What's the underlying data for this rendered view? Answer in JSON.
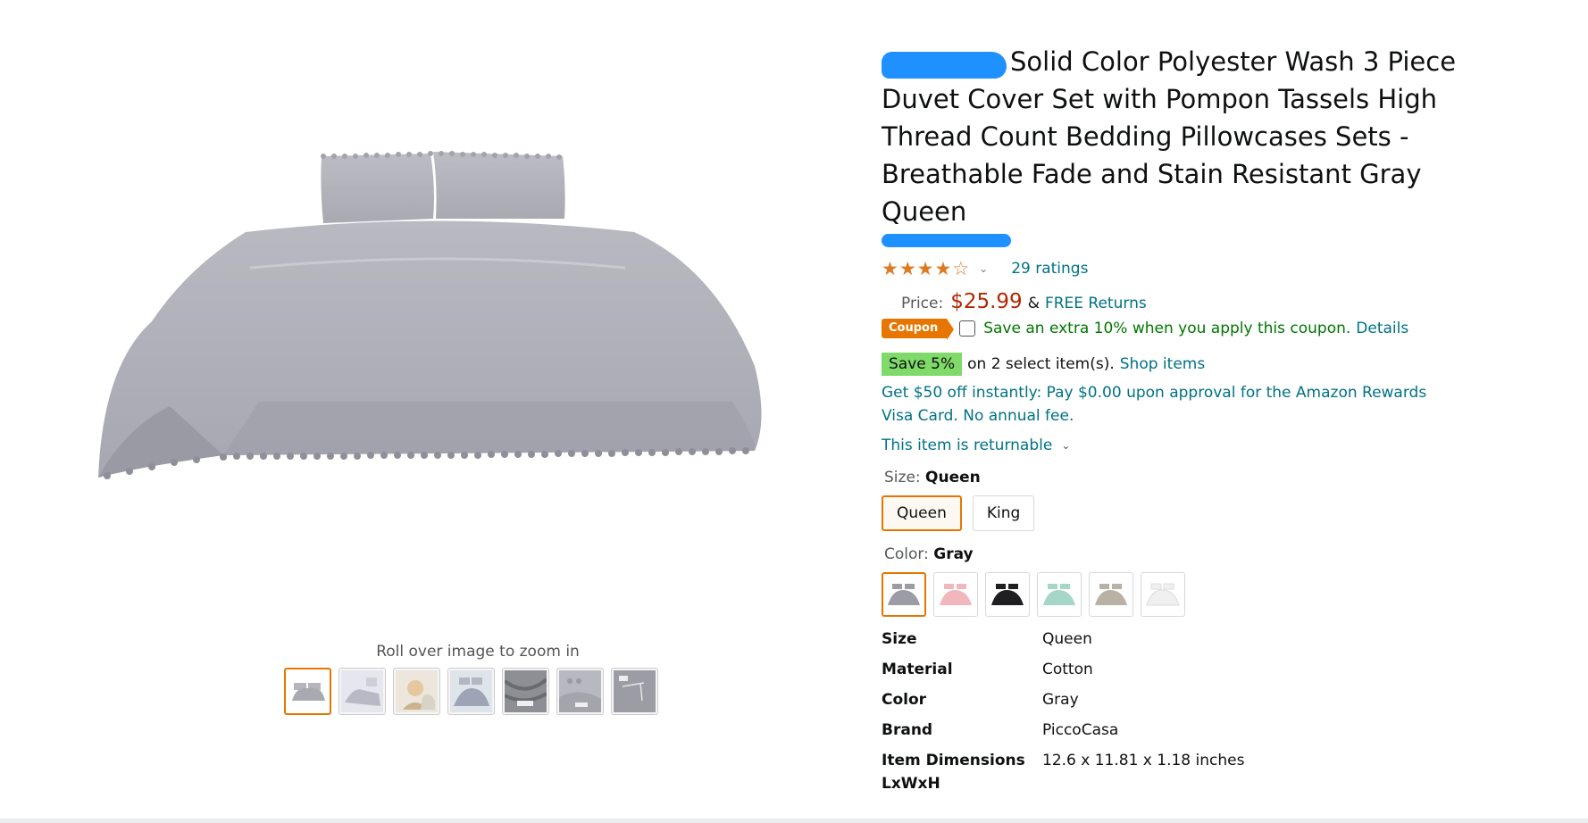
{
  "product": {
    "title": "Solid Color Polyester Wash 3 Piece Duvet Cover Set with Pompon Tassels High Thread Count Bedding Pillowcases Sets - Breathable Fade and Stain Resistant Gray Queen",
    "rating_value": 4,
    "ratings_link": "29 ratings",
    "price_label": "Price:",
    "price": "$25.99",
    "amp": "&",
    "free_returns": "FREE Returns",
    "coupon": {
      "badge": "Coupon",
      "text": "Save an extra 10% when you apply this coupon.",
      "details": "Details"
    },
    "promo": {
      "badge": "Save 5%",
      "text": "on 2 select item(s).",
      "link": "Shop items"
    },
    "visa_offer": "Get $50 off instantly: Pay $0.00 upon approval for the Amazon Rewards Visa Card. No annual fee.",
    "returnable": "This item is returnable",
    "size": {
      "label": "Size:",
      "selected": "Queen",
      "options": [
        "Queen",
        "King"
      ]
    },
    "color": {
      "label": "Color:",
      "selected": "Gray",
      "swatches": [
        "#9c9ca6",
        "#f2b6bd",
        "#1f1f22",
        "#a5d6c7",
        "#b9b1a5",
        "#f0f0f0"
      ]
    },
    "specs": [
      {
        "key": "Size",
        "value": "Queen"
      },
      {
        "key": "Material",
        "value": "Cotton"
      },
      {
        "key": "Color",
        "value": "Gray"
      },
      {
        "key": "Brand",
        "value": "PiccoCasa"
      },
      {
        "key": "Item Dimensions LxWxH",
        "value": "12.6 x 11.81 x 1.18 inches"
      }
    ]
  },
  "gallery": {
    "zoom_hint": "Roll over image to zoom in",
    "thumbnail_count": 7,
    "active_index": 0
  },
  "colors": {
    "link": "#007185",
    "price": "#b12704",
    "accent": "#e77600",
    "coupon_text": "#007600",
    "save_badge": "#7fda69",
    "redaction": "#1e90ff",
    "star": "#de7921"
  },
  "icons": {
    "star": "star-icon",
    "chevron": "chevron-down-icon",
    "checkbox": "checkbox-icon"
  }
}
